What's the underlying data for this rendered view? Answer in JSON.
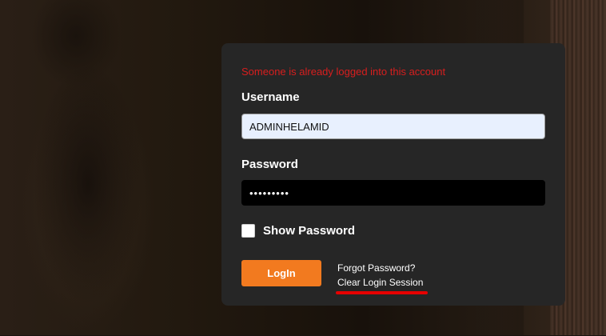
{
  "login": {
    "error_message": "Someone is already logged into this account",
    "username_label": "Username",
    "username_value": "ADMINHELAMID",
    "password_label": "Password",
    "password_value": "•••••••••",
    "show_password_label": "Show Password",
    "show_password_checked": false,
    "login_button": "LogIn",
    "forgot_password": "Forgot Password?",
    "clear_session": "Clear Login Session"
  },
  "colors": {
    "panel_bg": "#262626",
    "error": "#d81e1e",
    "button": "#f27a1f",
    "annotation_underline": "#e60000"
  }
}
